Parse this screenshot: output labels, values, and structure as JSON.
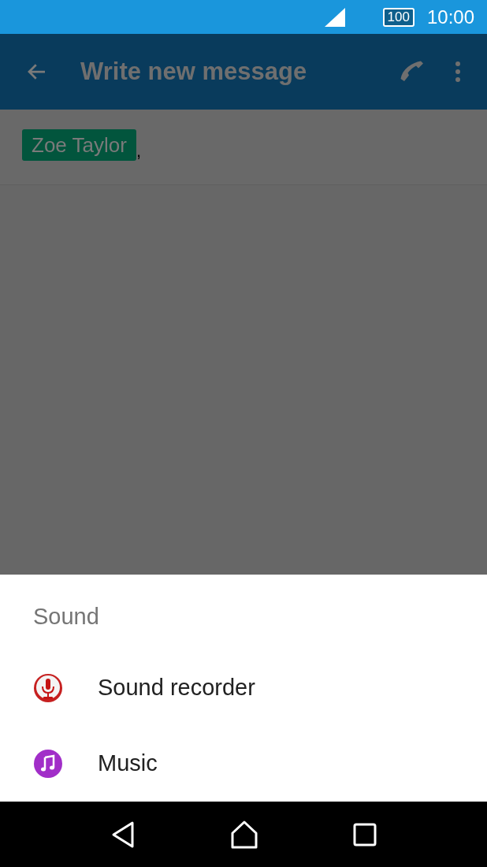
{
  "status_bar": {
    "battery": "100",
    "time": "10:00"
  },
  "app_bar": {
    "title": "Write new message"
  },
  "recipients": [
    {
      "name": "Zoe Taylor",
      "separator": ","
    }
  ],
  "sheet": {
    "title": "Sound",
    "items": [
      {
        "label": "Sound recorder",
        "kind": "recorder"
      },
      {
        "label": "Music",
        "kind": "music"
      }
    ]
  }
}
